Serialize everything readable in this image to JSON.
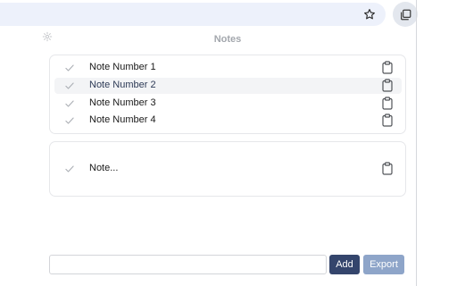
{
  "browser": {
    "star_icon": "star-outline-icon",
    "extension_icon": "copy-windows-icon"
  },
  "popup": {
    "settings_icon": "gear-icon",
    "title": "Notes",
    "notes": [
      {
        "text": "Note Number 1",
        "selected": false
      },
      {
        "text": "Note Number 2",
        "selected": true
      },
      {
        "text": "Note Number 3",
        "selected": false
      },
      {
        "text": "Note Number 4",
        "selected": false
      }
    ],
    "draft": {
      "text": "Note..."
    },
    "input": {
      "value": "",
      "placeholder": ""
    },
    "buttons": {
      "add": "Add",
      "export": "Export"
    }
  },
  "colors": {
    "add_button": "#34456c",
    "export_button": "#8ea5c9",
    "title_text": "#a3a7ad",
    "selected_row": "#f3f4f6"
  }
}
